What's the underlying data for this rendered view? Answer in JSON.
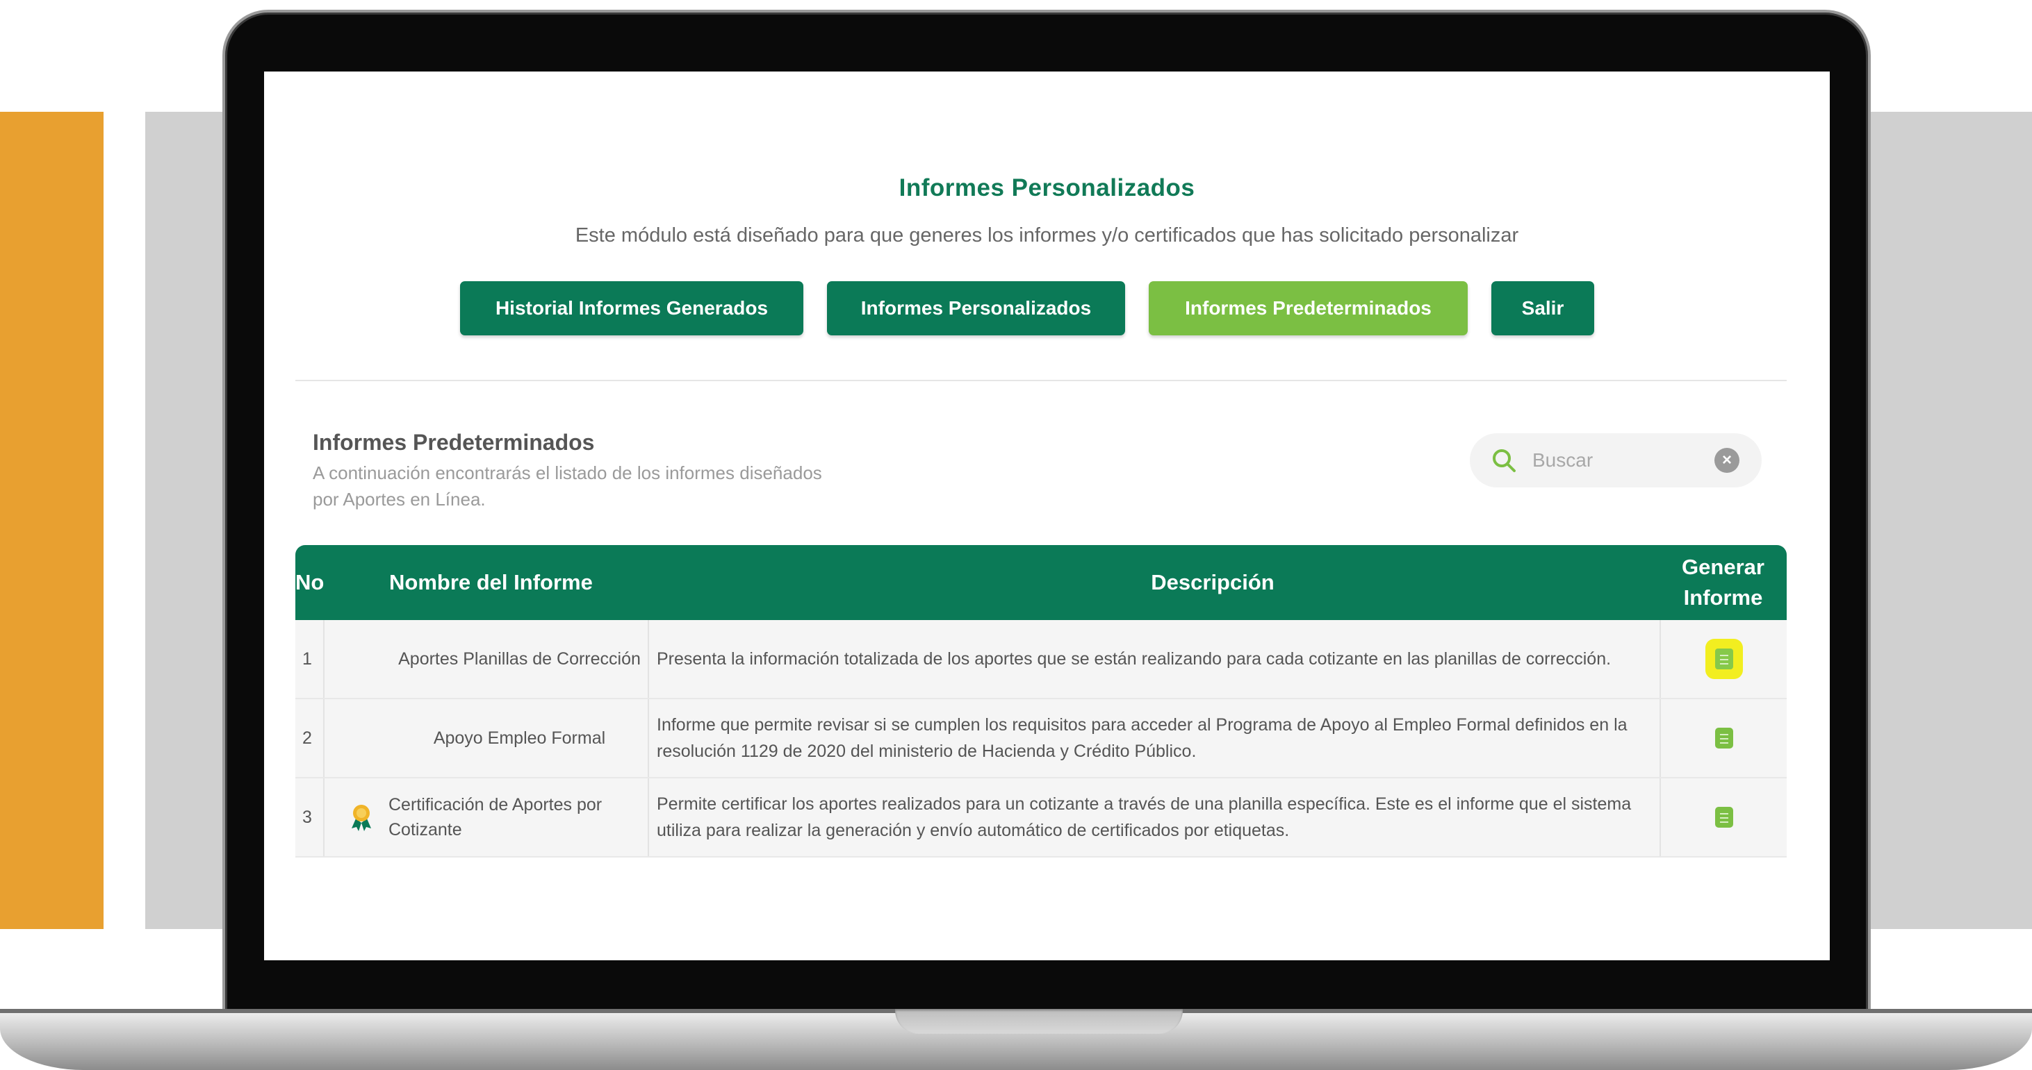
{
  "header": {
    "title": "Informes Personalizados",
    "subtitle": "Este módulo está diseñado para que generes los informes y/o certificados que has solicitado personalizar"
  },
  "nav_buttons": [
    {
      "label": "Historial Informes Generados",
      "active": false
    },
    {
      "label": "Informes Personalizados",
      "active": false
    },
    {
      "label": "Informes Predeterminados",
      "active": true
    },
    {
      "label": "Salir",
      "active": false
    }
  ],
  "section": {
    "title": "Informes Predeterminados",
    "description": "A continuación encontrarás el listado de los informes diseñados por Aportes en Línea."
  },
  "search": {
    "placeholder": "Buscar",
    "value": "",
    "icon": "search-icon",
    "clear_icon": "clear-icon"
  },
  "table": {
    "headers": {
      "no": "No",
      "name": "Nombre del Informe",
      "description": "Descripción",
      "generate": "Generar Informe"
    },
    "rows": [
      {
        "no": "1",
        "name": "Aportes Planillas de Corrección",
        "description": "Presenta la información totalizada de los aportes que se están realizando para cada cotizante en las planillas de corrección.",
        "icon": null,
        "generate_icon": "report-icon",
        "highlighted": true
      },
      {
        "no": "2",
        "name": "Apoyo Empleo Formal",
        "description": "Informe que permite revisar si se cumplen los requisitos para acceder al Programa de Apoyo al Empleo Formal definidos en la resolución 1129 de 2020 del ministerio de Hacienda y Crédito Público.",
        "icon": null,
        "generate_icon": "report-icon",
        "highlighted": false
      },
      {
        "no": "3",
        "name": "Certificación de Aportes por Cotizante",
        "description": "Permite certificar los aportes realizados para un cotizante a través de una planilla específica. Este es el informe que el sistema utiliza para realizar la generación y envío automático de certificados por etiquetas.",
        "icon": "award-ribbon-icon",
        "generate_icon": "report-icon",
        "highlighted": false
      }
    ]
  },
  "colors": {
    "primary_green": "#0b7a57",
    "active_green": "#7bbf43",
    "title_green": "#117a57",
    "highlight_yellow": "#f2ee20",
    "accent_orange": "#e8a030"
  }
}
